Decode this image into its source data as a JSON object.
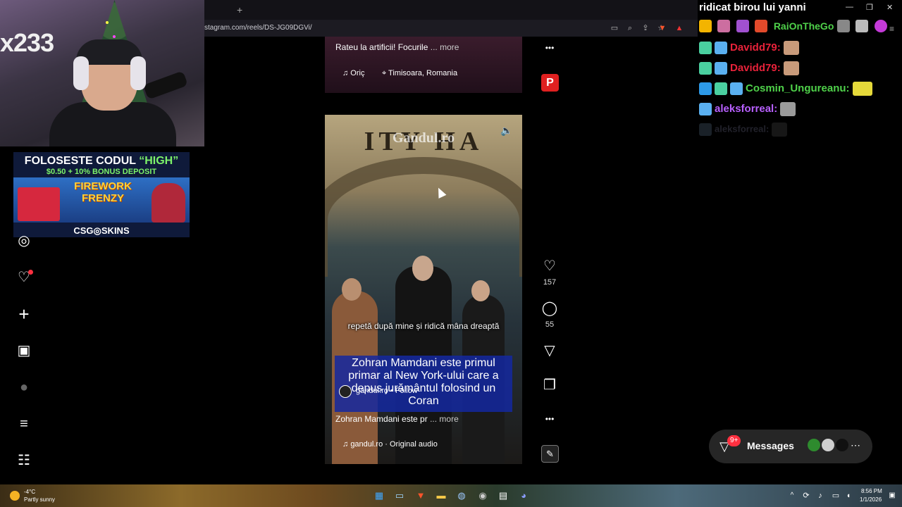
{
  "browser": {
    "new_tab": "+",
    "url": "stagram.com/reels/DS-JG09DGVi/"
  },
  "webcam": {
    "logo": "x233"
  },
  "promo": {
    "title_prefix": "FOLOSESTE CODUL ",
    "title_code": "“HIGH”",
    "subtitle": "$0.50 + 10% BONUS DEPOSIT",
    "game_line1": "FIREWORK",
    "game_line2": "FRENZY",
    "brand": "CSG◎SKINS"
  },
  "left_nav": [
    {
      "name": "explore-icon",
      "glyph": "◎"
    },
    {
      "name": "notifications-heart-icon",
      "glyph": "♡"
    },
    {
      "name": "create-plus-icon",
      "glyph": "+"
    },
    {
      "name": "dashboard-chart-icon",
      "glyph": "▣"
    },
    {
      "name": "profile-avatar-icon",
      "glyph": "●"
    },
    {
      "name": "menu-icon",
      "glyph": "≡"
    },
    {
      "name": "more-apps-icon",
      "glyph": "☷"
    }
  ],
  "reel_prev": {
    "caption": "Rateu la artificii! Focurile",
    "more": "... more",
    "audio_chip": "♫ Oriç",
    "location": "⌖ Timisoara, Romania"
  },
  "reel": {
    "sign_text": "ITY HA",
    "watermark": "Gandul.ro",
    "subtitle_small": "repetă după mine și ridică mâna dreaptă",
    "subtitle_big": "Zohran Mamdani este primul primar al New York-ului care a depus jurământul folosind un Coran",
    "author": "gandul.ro",
    "follow": "Follow",
    "caption": "Zohran Mamdani este pr",
    "more": "... more",
    "audio": "gandul.ro · Original audio",
    "likes": "157",
    "comments": "55"
  },
  "actions": {
    "more_glyph": "•••",
    "like_glyph": "♡",
    "comment_glyph": "◯",
    "share_glyph": "▽",
    "save_glyph": "❐",
    "brand_badge": "P",
    "audio_badge": "✎"
  },
  "chat": {
    "header": "ridicat birou lui yanni",
    "badge_user": "RaiOnTheGo",
    "lines": [
      {
        "user": "Davidd79:",
        "color": "#e8223a"
      },
      {
        "user": "Davidd79:",
        "color": "#e8223a"
      },
      {
        "user": "Cosmin_Ungureanu:",
        "color": "#4fd14a"
      },
      {
        "user": "aleksforreal:",
        "color": "#b860ff"
      },
      {
        "user": "aleksforreal:",
        "color": "#3a3a4a"
      }
    ]
  },
  "messages": {
    "label": "Messages",
    "badge": "9+",
    "more": "⋯"
  },
  "taskbar": {
    "temp": "-4°C",
    "weather": "Partly sunny",
    "time": "8:56 PM",
    "date": "1/1/2026"
  },
  "colors": {
    "accent_red": "#ff3040",
    "chat_bg": "#000000"
  }
}
